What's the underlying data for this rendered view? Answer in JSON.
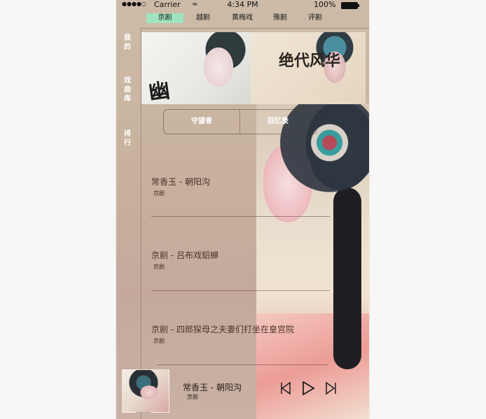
{
  "status_bar": {
    "signal": "●●●●○",
    "carrier": "Carrier",
    "wifi": "≈",
    "time": "4:34 PM",
    "battery_pct": "100%"
  },
  "top_tabs": [
    {
      "label": "京剧",
      "active": true
    },
    {
      "label": "越剧",
      "active": false
    },
    {
      "label": "黄梅戏",
      "active": false
    },
    {
      "label": "豫剧",
      "active": false
    },
    {
      "label": "评剧",
      "active": false
    }
  ],
  "left_nav": [
    {
      "label": "我的"
    },
    {
      "label": "戏曲库"
    },
    {
      "label": "排行"
    }
  ],
  "banner": {
    "left_calligraphy": "幽",
    "right_calligraphy": "绝代风华"
  },
  "segment": {
    "left": "守望者",
    "right": "回忆录"
  },
  "songs": [
    {
      "title": "常香玉 - 朝阳沟",
      "subtitle": "京剧"
    },
    {
      "title": "京剧 - 吕布戏貂蝉",
      "subtitle": "京剧"
    },
    {
      "title": "京剧 - 四郎探母之夫妻们打坐在皇宫院",
      "subtitle": "京剧"
    }
  ],
  "player": {
    "title": "常香玉 - 朝阳沟",
    "subtitle": "京剧",
    "prev_icon": "skip-previous-icon",
    "play_icon": "play-icon",
    "next_icon": "skip-next-icon"
  },
  "colors": {
    "active_tab": "#9fe3c0",
    "nav_text": "#ffffff"
  }
}
